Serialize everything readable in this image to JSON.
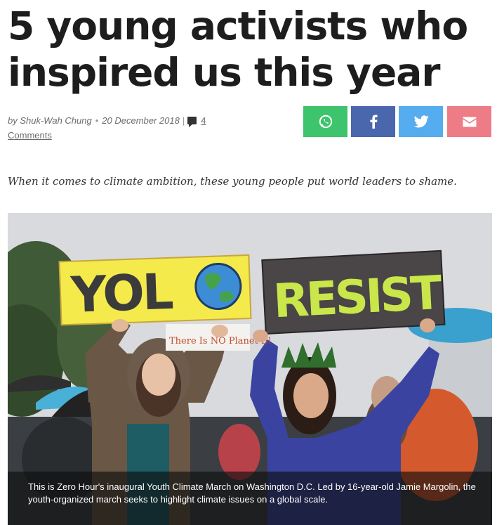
{
  "article": {
    "title": "5 young activists who inspired us this year",
    "author": "by Shuk-Wah Chung",
    "separator": "•",
    "date": "20 December 2018",
    "divider": "|",
    "comments_count": "4",
    "comments_label": "Comments",
    "dek": "When it comes to climate ambition, these young people put world leaders to shame."
  },
  "share": {
    "buttons": [
      {
        "name": "whatsapp",
        "icon": "whatsapp-icon",
        "color": "#3ec46d"
      },
      {
        "name": "facebook",
        "icon": "facebook-icon",
        "color": "#4a66ad"
      },
      {
        "name": "twitter",
        "icon": "twitter-icon",
        "color": "#55acee"
      },
      {
        "name": "email",
        "icon": "email-icon",
        "color": "#ee7c86"
      }
    ]
  },
  "photo": {
    "signs": {
      "left": "YOL",
      "right": "RESIST",
      "background_text": "There Is NO Planet B!"
    },
    "caption": "This is Zero Hour's inaugural Youth Climate March on Washington D.C. Led by 16-year-old Jamie Margolin, the youth-organized march seeks to highlight climate issues on a global scale."
  }
}
